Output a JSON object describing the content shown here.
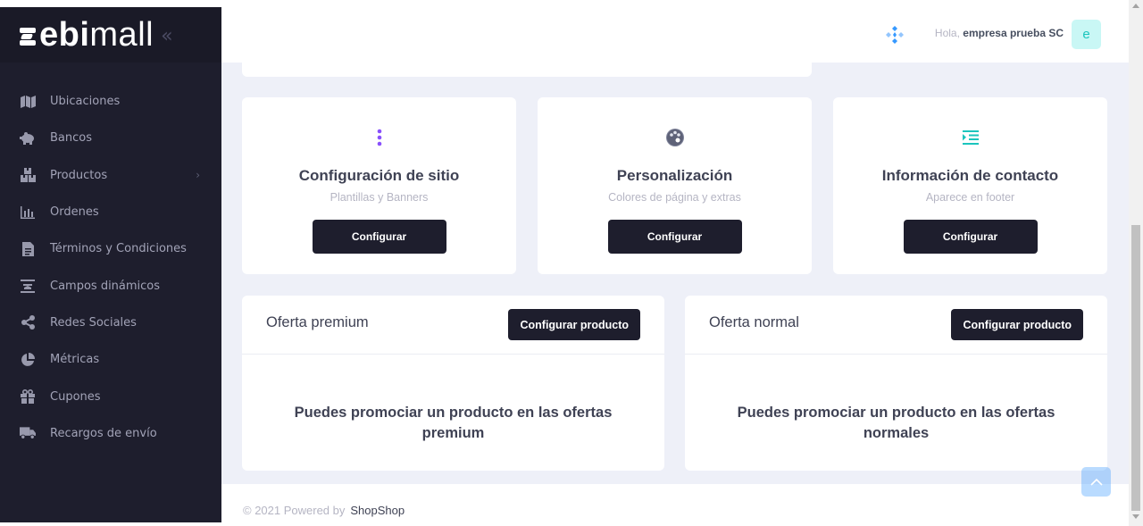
{
  "brand": {
    "logo_bold": "ebi",
    "logo_light": "mall"
  },
  "colors": {
    "sidebar_bg": "#1e1e2d",
    "accent_purple": "#8950fc",
    "accent_teal": "#1bc5bd",
    "button_dark": "#1e1e2d"
  },
  "sidebar": {
    "items": [
      {
        "label": "Ubicaciones",
        "icon": "map-icon"
      },
      {
        "label": "Bancos",
        "icon": "piggy-bank-icon"
      },
      {
        "label": "Productos",
        "icon": "boxes-icon",
        "has_submenu": true
      },
      {
        "label": "Ordenes",
        "icon": "bar-chart-icon"
      },
      {
        "label": "Términos y Condiciones",
        "icon": "document-icon"
      },
      {
        "label": "Campos dinámicos",
        "icon": "fields-icon"
      },
      {
        "label": "Redes Sociales",
        "icon": "share-icon"
      },
      {
        "label": "Métricas",
        "icon": "pie-chart-icon"
      },
      {
        "label": "Cupones",
        "icon": "gift-icon"
      },
      {
        "label": "Recargos de envío",
        "icon": "truck-icon"
      }
    ]
  },
  "header": {
    "greeting": "Hola,",
    "user_name": "empresa prueba SC",
    "avatar_letter": "e"
  },
  "config_cards": [
    {
      "title": "Configuración de sitio",
      "subtitle": "Plantillas y Banners",
      "button": "Configurar",
      "icon": "dots-vertical-icon"
    },
    {
      "title": "Personalización",
      "subtitle": "Colores de página y extras",
      "button": "Configurar",
      "icon": "palette-icon"
    },
    {
      "title": "Información de contacto",
      "subtitle": "Aparece en footer",
      "button": "Configurar",
      "icon": "list-indent-icon"
    }
  ],
  "offers": [
    {
      "title": "Oferta premium",
      "button": "Configurar producto",
      "body": "Puedes promociar un producto en las ofertas premium"
    },
    {
      "title": "Oferta normal",
      "button": "Configurar producto",
      "body": "Puedes promociar un producto en las ofertas normales"
    }
  ],
  "footer": {
    "copyright": "© 2021 Powered by",
    "brand": "ShopShop"
  }
}
